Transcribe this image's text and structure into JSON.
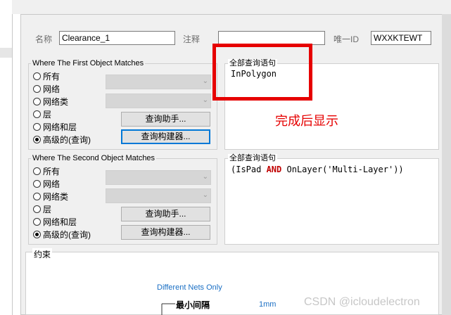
{
  "rule": {
    "name_label": "名称",
    "name_value": "Clearance_1",
    "comment_label": "注释",
    "comment_value": "",
    "uid_label": "唯一ID",
    "uid_value": "WXXKTEWT"
  },
  "first_object": {
    "title": "Where The First Object Matches",
    "options": [
      "所有",
      "网络",
      "网络类",
      "层",
      "网络和层",
      "高级的(查询)"
    ],
    "selected": "高级的(查询)",
    "query_helper_label": "查询助手...",
    "query_builder_label": "查询构建器...",
    "full_query_title": "全部查询语句",
    "full_query": "InPolygon"
  },
  "second_object": {
    "title": "Where The Second Object Matches",
    "options": [
      "所有",
      "网络",
      "网络类",
      "层",
      "网络和层",
      "高级的(查询)"
    ],
    "selected": "高级的(查询)",
    "query_helper_label": "查询助手...",
    "query_builder_label": "查询构建器...",
    "full_query_title": "全部查询语句",
    "full_query": {
      "part1": "(IsPad ",
      "keyword": "AND",
      "part2": " OnLayer('Multi-Layer'))"
    }
  },
  "annotation": {
    "text": "完成后显示",
    "color": "#e60000"
  },
  "constraints": {
    "title": "约束",
    "nets_mode": "Different Nets Only",
    "min_clearance_label": "最小间隔",
    "min_clearance_value": "1mm"
  },
  "watermark": "CSDN @icloudelectron"
}
